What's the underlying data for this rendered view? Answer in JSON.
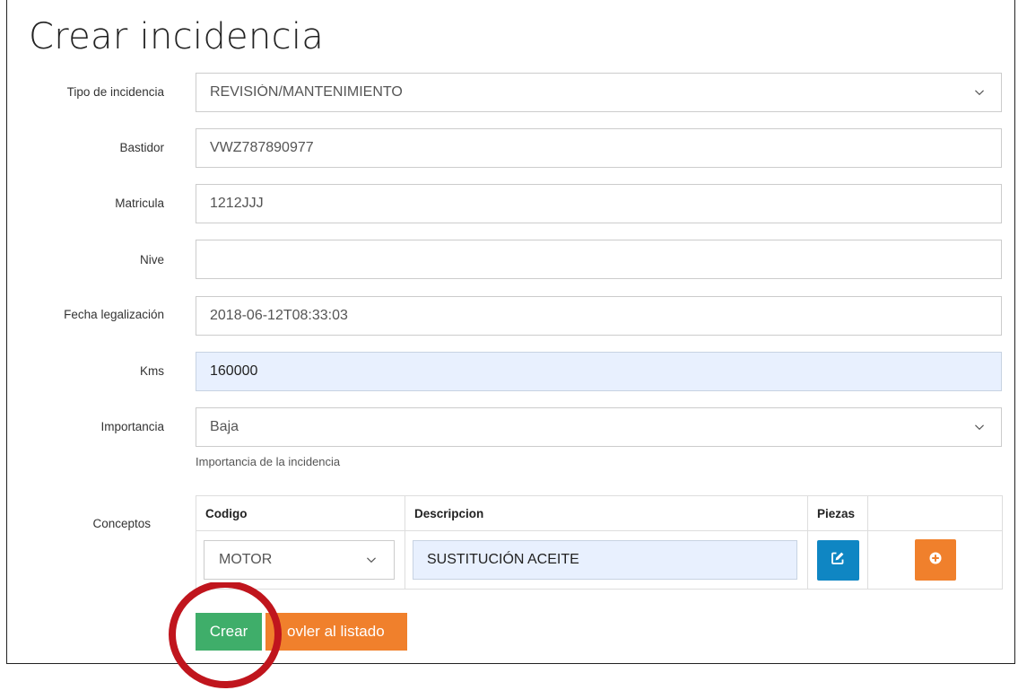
{
  "page": {
    "title": "Crear incidencia"
  },
  "form": {
    "tipo": {
      "label": "Tipo de incidencia",
      "value": "REVISIÓN/MANTENIMIENTO"
    },
    "bastidor": {
      "label": "Bastidor",
      "value": "VWZ787890977"
    },
    "matricula": {
      "label": "Matricula",
      "value": "1212JJJ"
    },
    "nive": {
      "label": "Nive",
      "value": ""
    },
    "fecha": {
      "label": "Fecha legalización",
      "value": "2018-06-12T08:33:03"
    },
    "kms": {
      "label": "Kms",
      "value": "160000"
    },
    "importancia": {
      "label": "Importancia",
      "value": "Baja",
      "help": "Importancia de la incidencia"
    }
  },
  "conceptos": {
    "label": "Conceptos",
    "headers": {
      "codigo": "Codigo",
      "descripcion": "Descripcion",
      "piezas": "Piezas",
      "actions": ""
    },
    "rows": [
      {
        "codigo": "MOTOR",
        "descripcion": "SUSTITUCIÓN ACEITE"
      }
    ]
  },
  "actions": {
    "crear": "Crear",
    "volver": "ovler al listado"
  },
  "icons": {
    "chevron": "chevron-down-icon",
    "edit": "edit-icon",
    "add": "plus-circle-icon"
  },
  "colors": {
    "crear": "#3fae6a",
    "volver": "#f0802c",
    "edit": "#0f86c3",
    "add": "#f0802c",
    "highlight_field": "#e8f0fe",
    "annotation_circle": "#c0151d"
  }
}
